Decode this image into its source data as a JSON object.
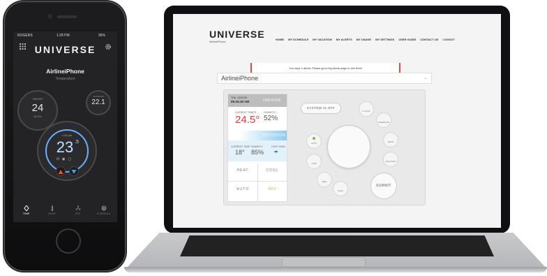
{
  "phone": {
    "status": {
      "carrier": "ROGERS",
      "time": "1:28 PM",
      "battery": "95%"
    },
    "logo": "UNIVERSE",
    "device_name": "AirlineiPhone",
    "subtitle": "Temperature",
    "indoor": {
      "label": "INDOOR",
      "temp": "24",
      "humidity": "60.3%"
    },
    "outdoor": {
      "label": "OUTDOOR",
      "temp": "22.1"
    },
    "main": {
      "time": "1:28 pm",
      "setpoint": "23",
      "decimal": ".5"
    },
    "tabs": [
      {
        "label": "TEMP"
      },
      {
        "label": "MODE"
      },
      {
        "label": "FAN"
      },
      {
        "label": "SCHEDULE"
      }
    ],
    "colors": {
      "accent_up": "#e85a2a",
      "accent_down": "#3aa0e8"
    }
  },
  "web": {
    "logo": "UNIVERSE",
    "logo_sub": "AirlineiPhone",
    "nav": [
      "HOME",
      "MY SCHEDULE",
      "MY VACATION",
      "MY ALERTS",
      "MY USAGE",
      "MY SETTINGS",
      "USER GUIDE",
      "CONTACT US",
      "LOGOUT"
    ],
    "alert_text": "You have 1 alerts. Please go to My Alerts page to see them",
    "device_selector": "AirlineiPhone",
    "panel": {
      "date": "THU, 10/12/26",
      "time": "05:34:30 AM",
      "indoor_label": "INDOOR",
      "current_temp_label": "CURRENT TEMPS",
      "current_temp": "24.5°",
      "humidity_label": "HUMIDITY",
      "humidity": "52%",
      "outdoor_label": "OUTDOOR",
      "out_temp_label": "CURRENT TEMP",
      "out_temp": "18°",
      "out_humidity_label": "HUMIDITY",
      "out_humidity": "85%",
      "lightrain_label": "LIGHT RAIN",
      "modes": [
        "HEAT",
        "COOL",
        "AUTO",
        "OFF"
      ],
      "system_status": "SYSTEM IS OFF",
      "side_buttons": [
        "F-HOLD",
        "SCHEDULE",
        "HOLD",
        "VACATION"
      ],
      "fan_buttons": [
        "AUTO",
        "LOW",
        "MED",
        "HIGH"
      ],
      "submit": "SUBMIT"
    }
  }
}
